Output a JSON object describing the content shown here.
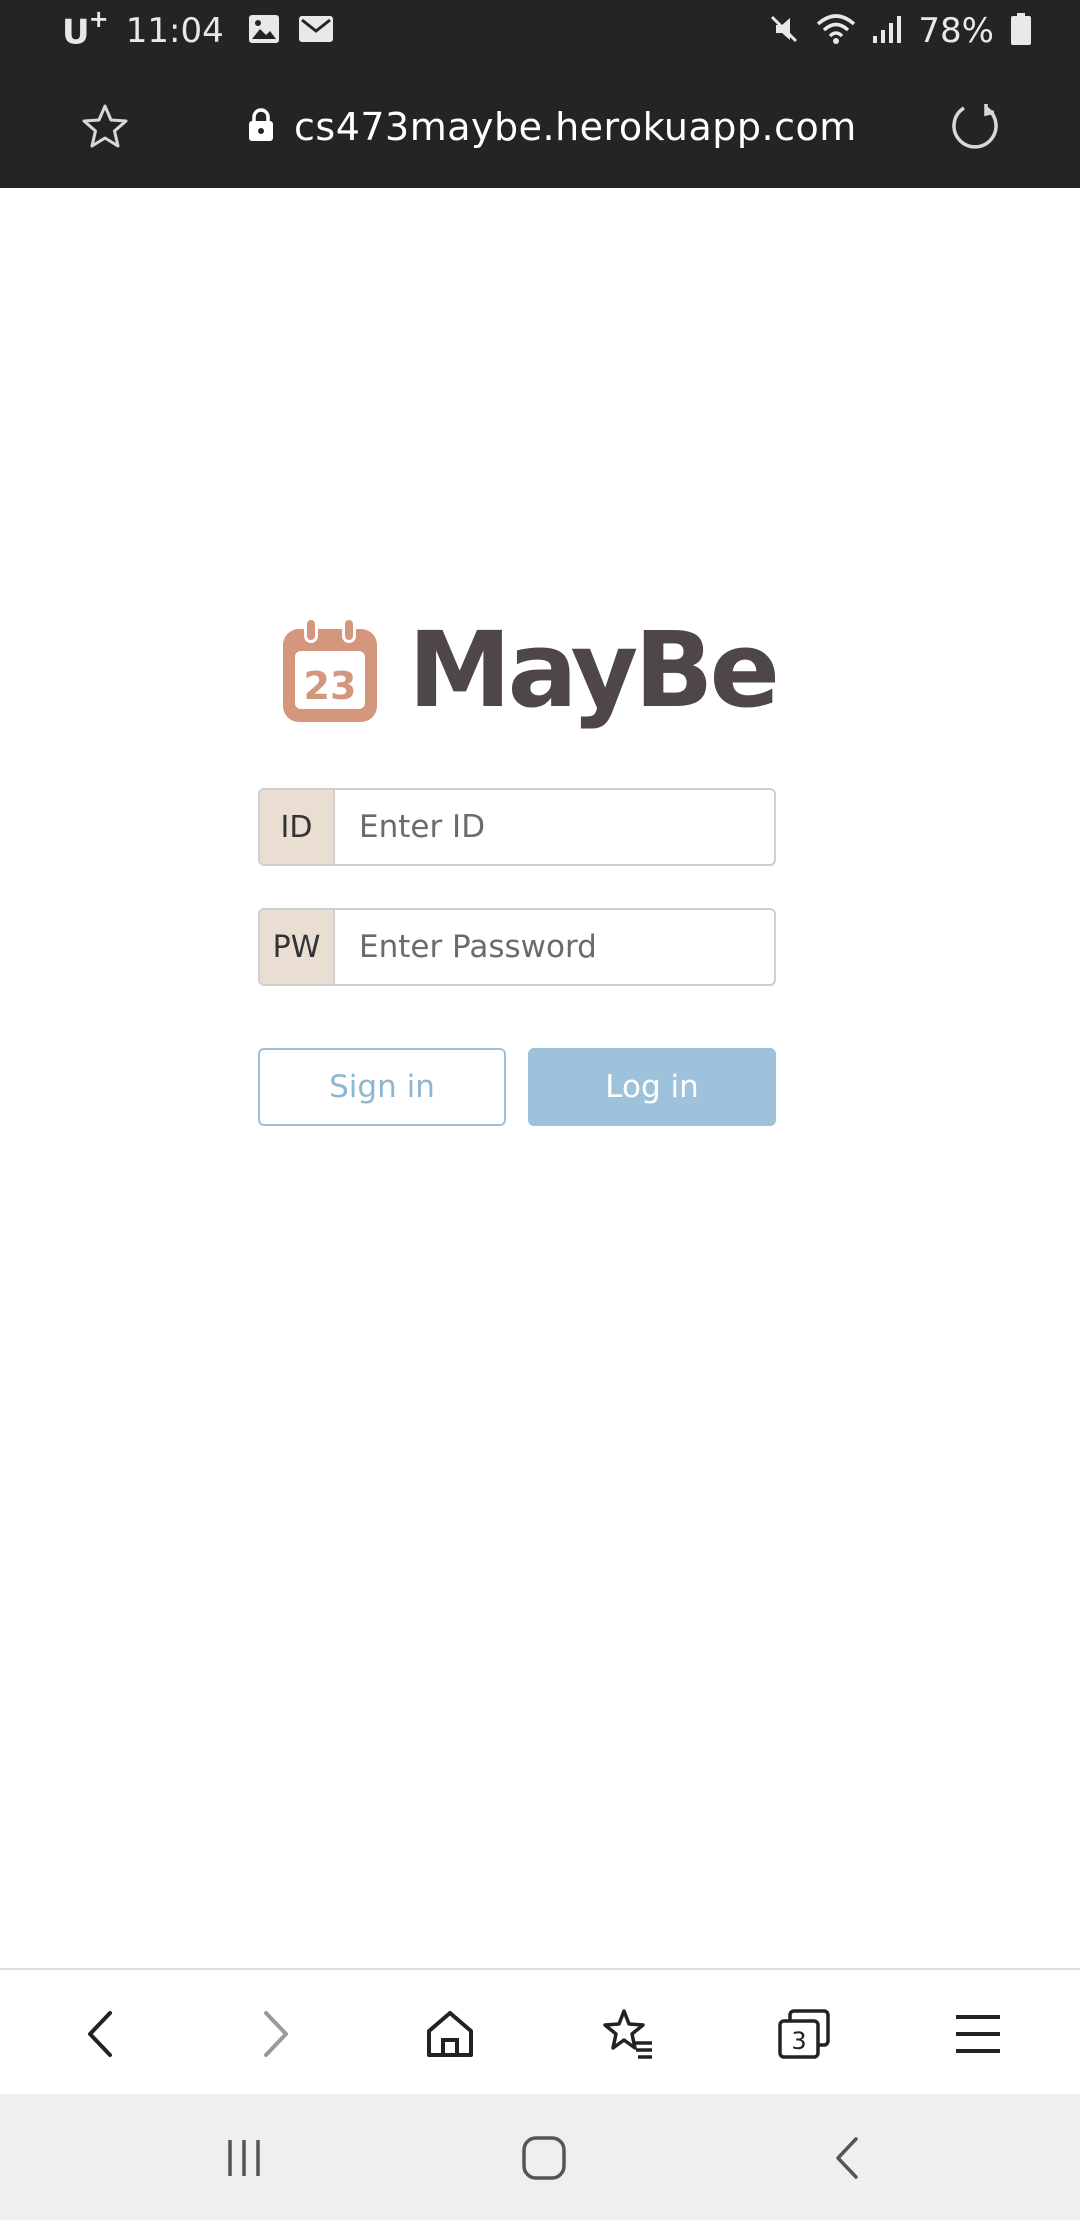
{
  "status_bar": {
    "carrier": "U",
    "carrier_sup": "+",
    "time": "11:04",
    "battery": "78%",
    "icons": [
      "image-icon",
      "mail-icon",
      "mute-icon",
      "wifi-icon",
      "signal-icon",
      "battery-icon"
    ]
  },
  "browser": {
    "url": "cs473maybe.herokuapp.com",
    "icons": [
      "star-icon",
      "lock-icon",
      "reload-icon"
    ]
  },
  "logo": {
    "calendar_day": "23",
    "brand": "MayBe",
    "icon_color": "#d4967c",
    "brand_color": "#4e4648"
  },
  "form": {
    "id_label": "ID",
    "id_placeholder": "Enter ID",
    "pw_label": "PW",
    "pw_placeholder": "Enter Password",
    "signin_label": "Sign in",
    "login_label": "Log in",
    "accent_color": "#9ec2db",
    "label_bg": "#eaded3"
  },
  "bottom_nav": {
    "tabs_count": "3",
    "icons": [
      "back-icon",
      "forward-icon",
      "home-icon",
      "bookmarks-icon",
      "tabs-icon",
      "menu-icon"
    ]
  },
  "system_nav": {
    "icons": [
      "recent-apps-icon",
      "home-circle-icon",
      "system-back-icon"
    ]
  }
}
